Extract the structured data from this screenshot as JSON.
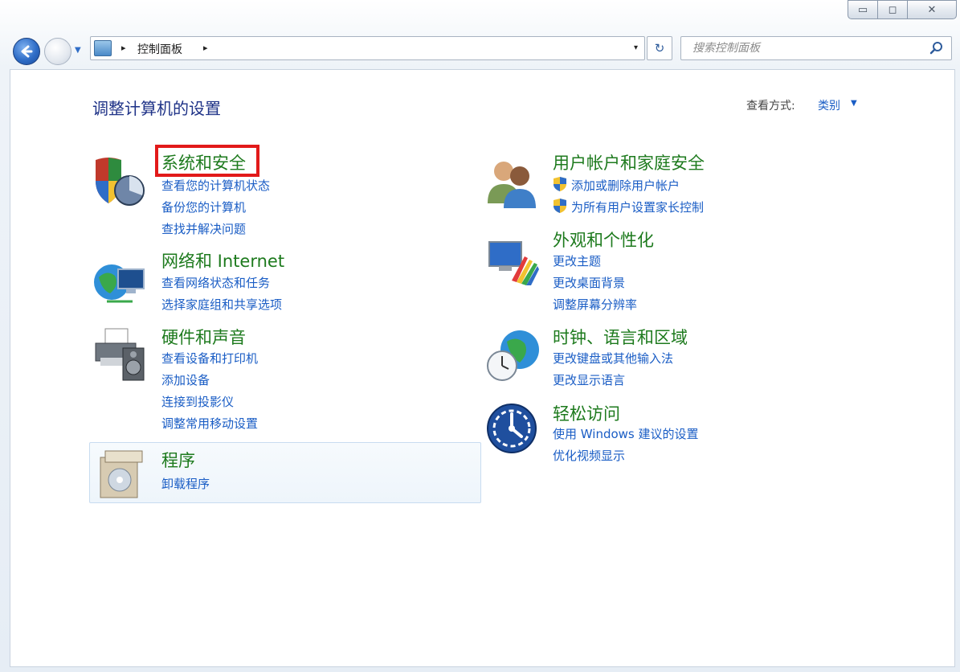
{
  "window": {
    "caption": {
      "minimize": "▭",
      "maximize": "◻",
      "close": "✕"
    }
  },
  "nav": {
    "address": {
      "root_sep": "▸",
      "path": "控制面板",
      "trail_sep": "▸",
      "dropdown": "▾"
    },
    "refresh_symbol": "↻",
    "search": {
      "placeholder": "搜索控制面板"
    }
  },
  "content": {
    "title": "调整计算机的设置",
    "view_by": {
      "label": "查看方式:",
      "value": "类别",
      "arrow": "▼"
    }
  },
  "categories": [
    {
      "title": "系统和安全",
      "icon": "shield-pie-icon",
      "links": [
        "查看您的计算机状态",
        "备份您的计算机",
        "查找并解决问题"
      ]
    },
    {
      "title": "网络和 Internet",
      "icon": "network-globe-icon",
      "links": [
        "查看网络状态和任务",
        "选择家庭组和共享选项"
      ]
    },
    {
      "title": "硬件和声音",
      "icon": "printer-speaker-icon",
      "links": [
        "查看设备和打印机",
        "添加设备",
        "连接到投影仪",
        "调整常用移动设置"
      ]
    },
    {
      "title": "程序",
      "icon": "program-box-icon",
      "links": [
        "卸载程序"
      ]
    },
    {
      "title": "用户帐户和家庭安全",
      "icon": "users-icon",
      "links": [
        "添加或删除用户帐户",
        "为所有用户设置家长控制"
      ]
    },
    {
      "title": "外观和个性化",
      "icon": "monitor-palette-icon",
      "links": [
        "更改主题",
        "更改桌面背景",
        "调整屏幕分辨率"
      ]
    },
    {
      "title": "时钟、语言和区域",
      "icon": "clock-globe-icon",
      "links": [
        "更改键盘或其他输入法",
        "更改显示语言"
      ]
    },
    {
      "title": "轻松访问",
      "icon": "ease-of-access-icon",
      "links": [
        "使用 Windows 建议的设置",
        "优化视频显示"
      ]
    }
  ],
  "colors": {
    "category_title": "#1d7a1d",
    "link": "#1a5dc5",
    "page_title": "#1e3287",
    "highlight_box": "#e21a1a"
  }
}
